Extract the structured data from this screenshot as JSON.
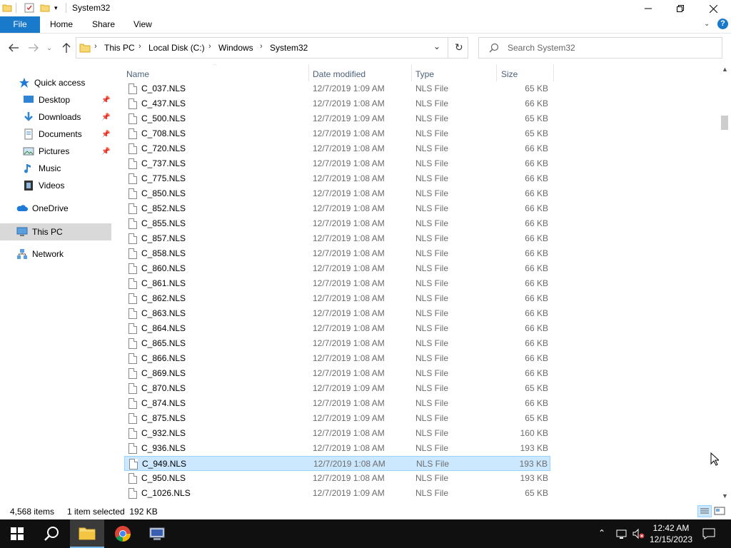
{
  "window": {
    "title": "System32"
  },
  "ribbon": {
    "tabs": [
      "File",
      "Home",
      "Share",
      "View"
    ]
  },
  "address": {
    "crumbs": [
      "This PC",
      "Local Disk (C:)",
      "Windows",
      "System32"
    ]
  },
  "search": {
    "placeholder": "Search System32"
  },
  "navpane": {
    "items": [
      {
        "label": "Quick access",
        "icon": "star-icon",
        "pinned": false
      },
      {
        "label": "Desktop",
        "icon": "desktop-icon",
        "pinned": true
      },
      {
        "label": "Downloads",
        "icon": "download-icon",
        "pinned": true
      },
      {
        "label": "Documents",
        "icon": "documents-icon",
        "pinned": true
      },
      {
        "label": "Pictures",
        "icon": "pictures-icon",
        "pinned": true
      },
      {
        "label": "Music",
        "icon": "music-icon",
        "pinned": false
      },
      {
        "label": "Videos",
        "icon": "videos-icon",
        "pinned": false
      },
      {
        "label": "OneDrive",
        "icon": "onedrive-icon",
        "pinned": false
      },
      {
        "label": "This PC",
        "icon": "computer-icon",
        "pinned": false
      },
      {
        "label": "Network",
        "icon": "network-icon",
        "pinned": false
      }
    ]
  },
  "columns": {
    "name": "Name",
    "date": "Date modified",
    "type": "Type",
    "size": "Size"
  },
  "files": [
    {
      "name": "C_037.NLS",
      "date": "12/7/2019 1:09 AM",
      "type": "NLS File",
      "size": "65 KB"
    },
    {
      "name": "C_437.NLS",
      "date": "12/7/2019 1:08 AM",
      "type": "NLS File",
      "size": "66 KB"
    },
    {
      "name": "C_500.NLS",
      "date": "12/7/2019 1:09 AM",
      "type": "NLS File",
      "size": "65 KB"
    },
    {
      "name": "C_708.NLS",
      "date": "12/7/2019 1:08 AM",
      "type": "NLS File",
      "size": "65 KB"
    },
    {
      "name": "C_720.NLS",
      "date": "12/7/2019 1:08 AM",
      "type": "NLS File",
      "size": "66 KB"
    },
    {
      "name": "C_737.NLS",
      "date": "12/7/2019 1:08 AM",
      "type": "NLS File",
      "size": "66 KB"
    },
    {
      "name": "C_775.NLS",
      "date": "12/7/2019 1:08 AM",
      "type": "NLS File",
      "size": "66 KB"
    },
    {
      "name": "C_850.NLS",
      "date": "12/7/2019 1:08 AM",
      "type": "NLS File",
      "size": "66 KB"
    },
    {
      "name": "C_852.NLS",
      "date": "12/7/2019 1:08 AM",
      "type": "NLS File",
      "size": "66 KB"
    },
    {
      "name": "C_855.NLS",
      "date": "12/7/2019 1:08 AM",
      "type": "NLS File",
      "size": "66 KB"
    },
    {
      "name": "C_857.NLS",
      "date": "12/7/2019 1:08 AM",
      "type": "NLS File",
      "size": "66 KB"
    },
    {
      "name": "C_858.NLS",
      "date": "12/7/2019 1:08 AM",
      "type": "NLS File",
      "size": "66 KB"
    },
    {
      "name": "C_860.NLS",
      "date": "12/7/2019 1:08 AM",
      "type": "NLS File",
      "size": "66 KB"
    },
    {
      "name": "C_861.NLS",
      "date": "12/7/2019 1:08 AM",
      "type": "NLS File",
      "size": "66 KB"
    },
    {
      "name": "C_862.NLS",
      "date": "12/7/2019 1:08 AM",
      "type": "NLS File",
      "size": "66 KB"
    },
    {
      "name": "C_863.NLS",
      "date": "12/7/2019 1:08 AM",
      "type": "NLS File",
      "size": "66 KB"
    },
    {
      "name": "C_864.NLS",
      "date": "12/7/2019 1:08 AM",
      "type": "NLS File",
      "size": "66 KB"
    },
    {
      "name": "C_865.NLS",
      "date": "12/7/2019 1:08 AM",
      "type": "NLS File",
      "size": "66 KB"
    },
    {
      "name": "C_866.NLS",
      "date": "12/7/2019 1:08 AM",
      "type": "NLS File",
      "size": "66 KB"
    },
    {
      "name": "C_869.NLS",
      "date": "12/7/2019 1:08 AM",
      "type": "NLS File",
      "size": "66 KB"
    },
    {
      "name": "C_870.NLS",
      "date": "12/7/2019 1:09 AM",
      "type": "NLS File",
      "size": "65 KB"
    },
    {
      "name": "C_874.NLS",
      "date": "12/7/2019 1:08 AM",
      "type": "NLS File",
      "size": "66 KB"
    },
    {
      "name": "C_875.NLS",
      "date": "12/7/2019 1:09 AM",
      "type": "NLS File",
      "size": "65 KB"
    },
    {
      "name": "C_932.NLS",
      "date": "12/7/2019 1:08 AM",
      "type": "NLS File",
      "size": "160 KB"
    },
    {
      "name": "C_936.NLS",
      "date": "12/7/2019 1:08 AM",
      "type": "NLS File",
      "size": "193 KB"
    },
    {
      "name": "C_949.NLS",
      "date": "12/7/2019 1:08 AM",
      "type": "NLS File",
      "size": "193 KB",
      "selected": true
    },
    {
      "name": "C_950.NLS",
      "date": "12/7/2019 1:08 AM",
      "type": "NLS File",
      "size": "193 KB"
    },
    {
      "name": "C_1026.NLS",
      "date": "12/7/2019 1:09 AM",
      "type": "NLS File",
      "size": "65 KB"
    }
  ],
  "status": {
    "item_count": "4,568 items",
    "selection": "1 item selected  192 KB"
  },
  "taskbar": {
    "time": "12:42 AM",
    "date": "12/15/2023"
  },
  "colors": {
    "accent": "#1979ca",
    "selection_bg": "#cce8ff",
    "selection_border": "#99d1ff",
    "taskbar_bg": "#101010"
  }
}
